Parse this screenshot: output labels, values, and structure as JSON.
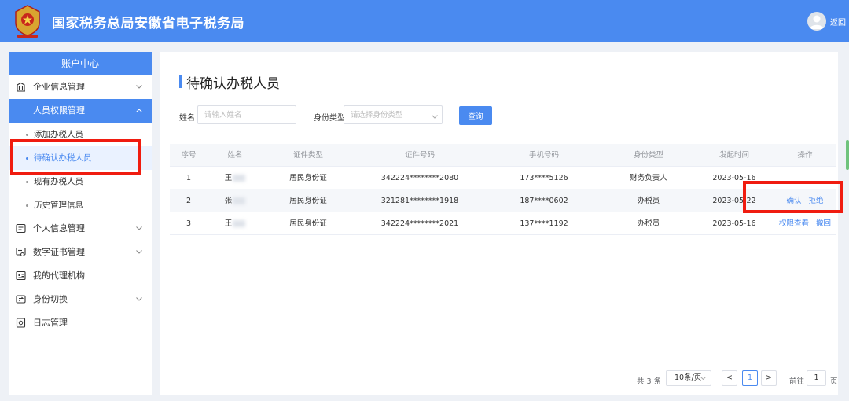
{
  "header": {
    "title": "国家税务总局安徽省电子税务局",
    "back_label": "返回",
    "logo_icon": "tax-emblem-icon"
  },
  "colors": {
    "primary": "#4a8af0",
    "highlight": "#f01c10",
    "background": "#eef1f6"
  },
  "sidebar": {
    "heading": "账户中心",
    "menu": [
      {
        "label": "企业信息管理",
        "icon": "building-icon"
      },
      {
        "label": "人员权限管理",
        "icon": "",
        "active": true
      },
      {
        "label": "添加办税人员"
      },
      {
        "label": "待确认办税人员",
        "current": true
      },
      {
        "label": "现有办税人员"
      },
      {
        "label": "历史管理信息"
      },
      {
        "label": "个人信息管理",
        "icon": "id-card-icon"
      },
      {
        "label": "数字证书管理",
        "icon": "certificate-icon"
      },
      {
        "label": "我的代理机构",
        "icon": "agency-icon"
      },
      {
        "label": "身份切换",
        "icon": "switch-icon"
      },
      {
        "label": "日志管理",
        "icon": "log-icon"
      }
    ]
  },
  "page": {
    "title": "待确认办税人员"
  },
  "filters": {
    "name_label": "姓名",
    "name_placeholder": "请输入姓名",
    "type_label": "身份类型",
    "type_placeholder": "请选择身份类型",
    "query_label": "查询"
  },
  "table": {
    "headers": [
      "序号",
      "姓名",
      "证件类型",
      "证件号码",
      "手机号码",
      "身份类型",
      "发起时间",
      "操作"
    ],
    "rows": [
      {
        "no": "1",
        "name": "王",
        "id_type": "居民身份证",
        "id_number": "342224********2080",
        "phone": "173****5126",
        "role": "财务负责人",
        "date": "2023-05-16",
        "actions": []
      },
      {
        "no": "2",
        "name": "张",
        "id_type": "居民身份证",
        "id_number": "321281********1918",
        "phone": "187****0602",
        "role": "办税员",
        "date": "2023-05-22",
        "actions": [
          "确认",
          "拒绝"
        ]
      },
      {
        "no": "3",
        "name": "王",
        "id_type": "居民身份证",
        "id_number": "342224********2021",
        "phone": "137****1192",
        "role": "办税员",
        "date": "2023-05-16",
        "actions": [
          "权限查看",
          "撤回"
        ]
      }
    ]
  },
  "pagination": {
    "total": "共 3 条",
    "page_size": "10条/页",
    "prev": "<",
    "current_page": "1",
    "next": ">",
    "goto_label": "前往",
    "goto_value": "1",
    "page_suffix": "页"
  }
}
